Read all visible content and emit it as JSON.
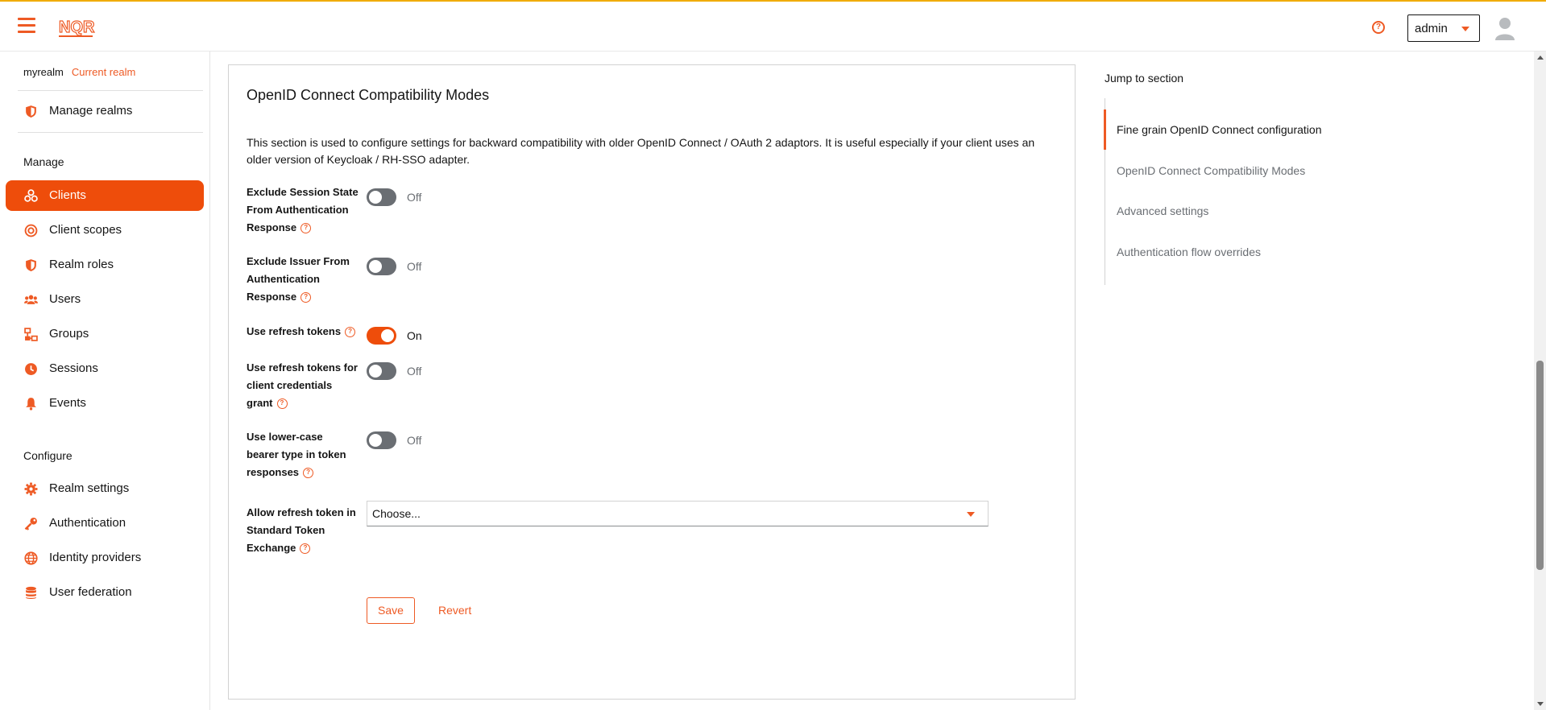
{
  "header": {
    "user_name": "admin",
    "icons": {
      "menu": "hamburger-menu-icon",
      "help": "help-icon",
      "avatar": "user-avatar-icon",
      "logo": "brand-logo"
    }
  },
  "sidebar": {
    "realm_name": "myrealm",
    "realm_badge": "Current realm",
    "manage_realms": "Manage realms",
    "manage_heading": "Manage",
    "configure_heading": "Configure",
    "manage_items": [
      {
        "label": "Clients",
        "icon": "clients-icon",
        "active": true
      },
      {
        "label": "Client scopes",
        "icon": "client-scopes-icon"
      },
      {
        "label": "Realm roles",
        "icon": "realm-roles-icon"
      },
      {
        "label": "Users",
        "icon": "users-icon"
      },
      {
        "label": "Groups",
        "icon": "groups-icon"
      },
      {
        "label": "Sessions",
        "icon": "sessions-icon"
      },
      {
        "label": "Events",
        "icon": "events-icon"
      }
    ],
    "configure_items": [
      {
        "label": "Realm settings",
        "icon": "gear-icon"
      },
      {
        "label": "Authentication",
        "icon": "key-icon"
      },
      {
        "label": "Identity providers",
        "icon": "globe-icon"
      },
      {
        "label": "User federation",
        "icon": "database-icon"
      }
    ]
  },
  "main": {
    "title": "OpenID Connect Compatibility Modes",
    "description": "This section is used to configure settings for backward compatibility with older OpenID Connect / OAuth 2 adaptors. It is useful especially if your client uses an older version of Keycloak / RH-SSO adapter.",
    "fields": [
      {
        "label": "Exclude Session State From Authentication Response",
        "state": "Off"
      },
      {
        "label": "Exclude Issuer From Authentication Response",
        "state": "Off"
      },
      {
        "label": "Use refresh tokens",
        "state": "On"
      },
      {
        "label": "Use refresh tokens for client credentials grant",
        "state": "Off"
      },
      {
        "label": "Use lower-case bearer type in token responses",
        "state": "Off"
      }
    ],
    "select_field": {
      "label": "Allow refresh token in Standard Token Exchange",
      "value": "Choose..."
    },
    "save_label": "Save",
    "revert_label": "Revert"
  },
  "jump": {
    "title": "Jump to section",
    "items": [
      "Fine grain OpenID Connect configuration",
      "OpenID Connect Compatibility Modes",
      "Advanced settings",
      "Authentication flow overrides"
    ]
  },
  "colors": {
    "accent": "#ee5a24",
    "active_nav": "#ee4d0b",
    "toggle_off": "#6a6e73"
  }
}
